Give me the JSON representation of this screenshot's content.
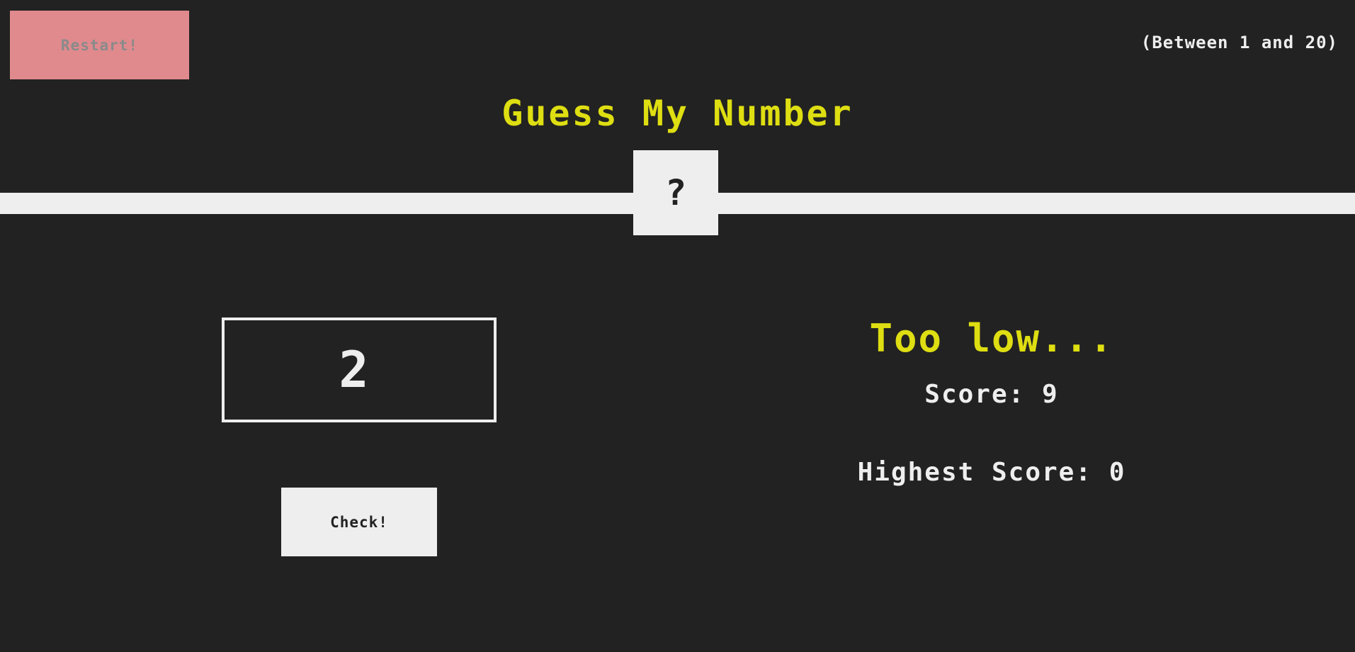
{
  "header": {
    "restart_label": "Restart!",
    "range_hint": "(Between 1 and 20)",
    "title": "Guess My Number",
    "secret_display": "?"
  },
  "game": {
    "guess_value": "2",
    "check_label": "Check!",
    "message": "Too low...",
    "score_label": "Score:",
    "score_value": "9",
    "highscore_label": "Highest Score:",
    "highscore_value": "0"
  },
  "colors": {
    "background": "#222222",
    "foreground": "#eeeeee",
    "accent": "#dede12",
    "restart_button": "#e08a8e"
  }
}
